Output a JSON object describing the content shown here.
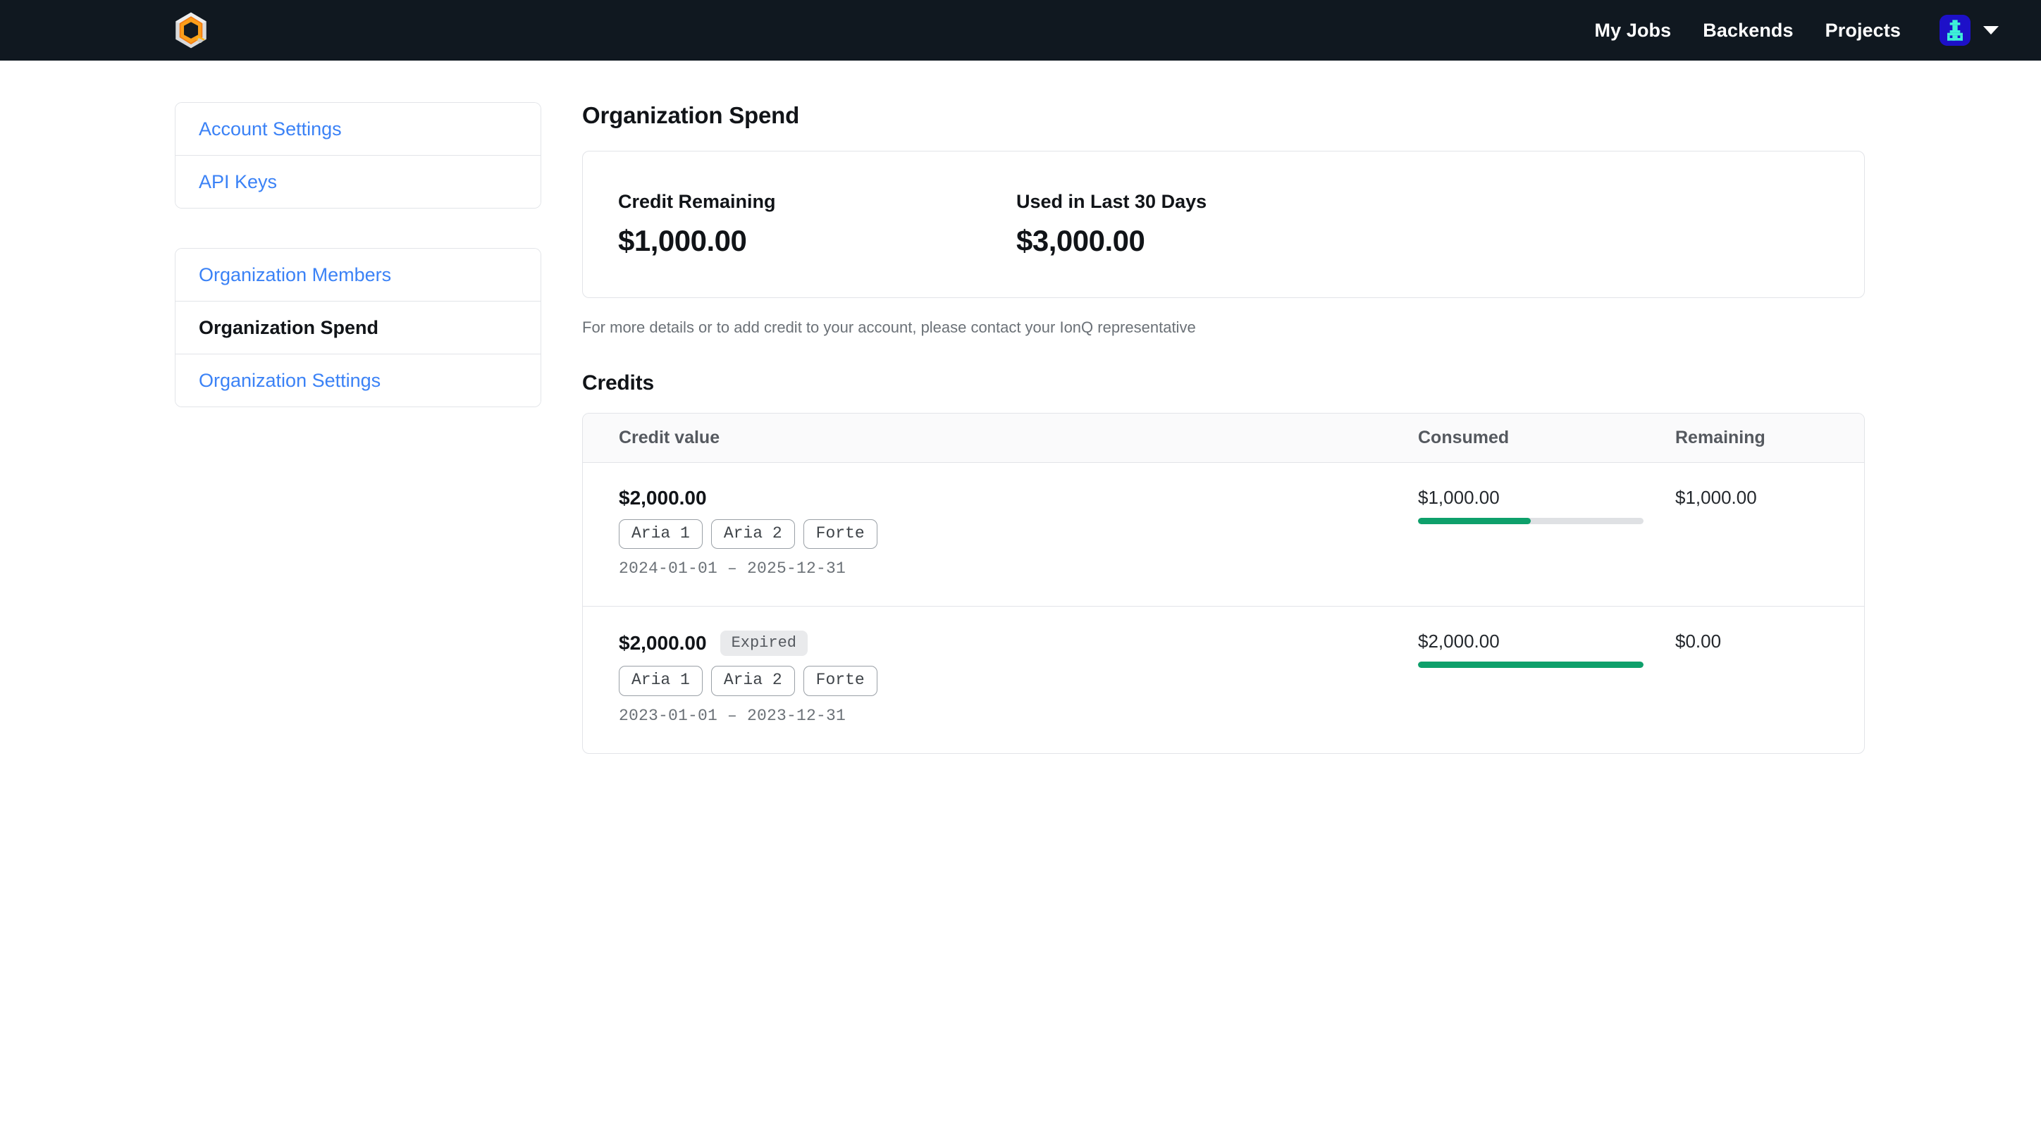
{
  "navbar": {
    "logo_name": "ionq-logo",
    "links": [
      {
        "label": "My Jobs"
      },
      {
        "label": "Backends"
      },
      {
        "label": "Projects"
      }
    ],
    "avatar_name": "user-avatar",
    "chevron_name": "chevron-down-icon"
  },
  "sidebar": {
    "groups": [
      {
        "items": [
          {
            "label": "Account Settings",
            "active": false
          },
          {
            "label": "API Keys",
            "active": false
          }
        ]
      },
      {
        "items": [
          {
            "label": "Organization Members",
            "active": false
          },
          {
            "label": "Organization Spend",
            "active": true
          },
          {
            "label": "Organization Settings",
            "active": false
          }
        ]
      }
    ]
  },
  "main": {
    "page_title": "Organization Spend",
    "summary": {
      "credit_remaining_label": "Credit Remaining",
      "credit_remaining_value": "$1,000.00",
      "used_last_30_label": "Used in Last 30 Days",
      "used_last_30_value": "$3,000.00"
    },
    "helper_text": "For more details or to add credit to your account, please contact your IonQ representative",
    "credits_section_title": "Credits",
    "table": {
      "headers": {
        "credit_value": "Credit value",
        "consumed": "Consumed",
        "remaining": "Remaining"
      },
      "rows": [
        {
          "credit_value": "$2,000.00",
          "status_badge": null,
          "devices": [
            "Aria 1",
            "Aria 2",
            "Forte"
          ],
          "date_range": "2024-01-01 – 2025-12-31",
          "consumed": "$1,000.00",
          "remaining": "$1,000.00",
          "progress_percent": 50
        },
        {
          "credit_value": "$2,000.00",
          "status_badge": "Expired",
          "devices": [
            "Aria 1",
            "Aria 2",
            "Forte"
          ],
          "date_range": "2023-01-01 – 2023-12-31",
          "consumed": "$2,000.00",
          "remaining": "$0.00",
          "progress_percent": 100
        }
      ]
    }
  },
  "colors": {
    "navbar_background": "#101820",
    "link_blue": "#3b82f6",
    "progress_green": "#0ea06b",
    "progress_track": "#dfe1e4",
    "border": "#e2e4e8"
  }
}
